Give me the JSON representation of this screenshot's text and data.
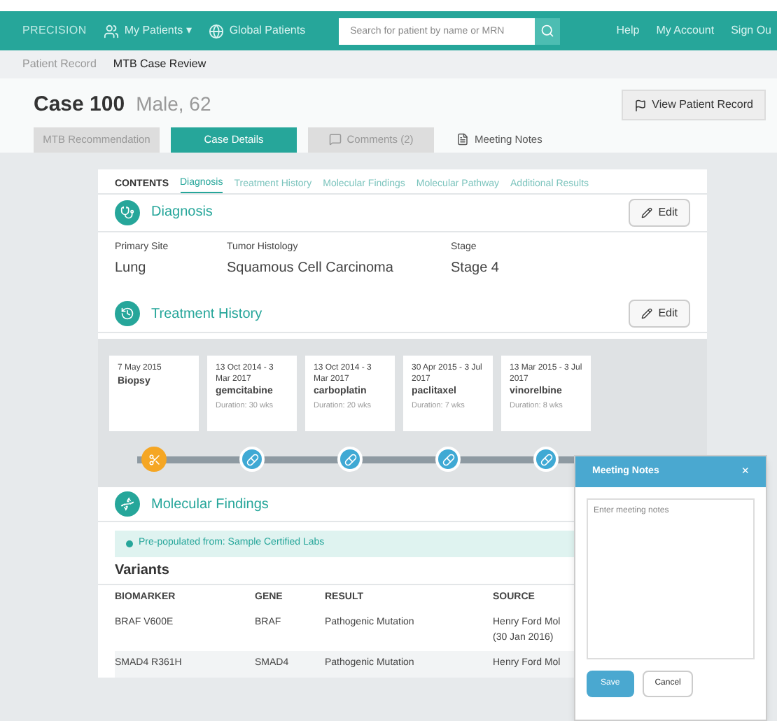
{
  "navbar": {
    "logo": "PRECISION",
    "menu": [
      {
        "label": "My Patients ▾",
        "kind": "patients"
      },
      {
        "label": "Global Patients",
        "kind": "globe"
      }
    ],
    "search": {
      "placeholder": "Search for patient by name or MRN"
    },
    "links": [
      "Help",
      "My Account",
      "Sign Ou"
    ]
  },
  "breadcrumb": [
    {
      "label": "Patient Record",
      "selected": false
    },
    {
      "label": "MTB Case Review",
      "selected": true
    }
  ],
  "header": {
    "title": "Case 100",
    "subtitle": "Male, 62",
    "button": "View Patient Record"
  },
  "tabs": [
    {
      "label": "MTB Recommendation",
      "selected": false,
      "kind": "plain"
    },
    {
      "label": "Case Details",
      "selected": true,
      "kind": "plain"
    },
    {
      "label": "Comments (2)",
      "selected": false,
      "kind": "comments"
    },
    {
      "label": "Meeting Notes",
      "selected": false,
      "kind": "link"
    }
  ],
  "contents": {
    "label": "CONTENTS",
    "items": [
      {
        "label": "Diagnosis",
        "selected": true
      },
      {
        "label": "Treatment History",
        "selected": false
      },
      {
        "label": "Molecular Findings",
        "selected": false
      },
      {
        "label": "Molecular Pathway",
        "selected": false
      },
      {
        "label": "Additional Results",
        "selected": false
      }
    ]
  },
  "diagnosis": {
    "title": "Diagnosis",
    "edit": "Edit",
    "fields": [
      {
        "label": "Primary Site",
        "value": "Lung"
      },
      {
        "label": "Tumor Histology",
        "value": "Squamous Cell Carcinoma"
      },
      {
        "label": "Stage",
        "value": "Stage 4"
      }
    ]
  },
  "treatment": {
    "title": "Treatment History",
    "edit": "Edit",
    "events": [
      {
        "kind": "procedure",
        "date": "7 May 2015",
        "name": "Biopsy"
      },
      {
        "kind": "drug",
        "date": "13 Oct 2014 - 3 Mar 2017",
        "name": "gemcitabine",
        "duration": "Duration: 30 wks"
      },
      {
        "kind": "drug",
        "date": "13 Oct 2014 - 3 Mar 2017",
        "name": "carboplatin",
        "duration": "Duration: 20 wks"
      },
      {
        "kind": "drug",
        "date": "30 Apr 2015 - 3 Jul 2017",
        "name": "paclitaxel",
        "duration": "Duration: 7 wks"
      },
      {
        "kind": "drug",
        "date": "13 Mar 2015 - 3 Jul 2017",
        "name": "vinorelbine",
        "duration": "Duration: 8 wks"
      }
    ]
  },
  "molecular": {
    "title": "Molecular Findings",
    "alert": "Pre-populated from: Sample Certified Labs",
    "subtitle": "Variants",
    "columns": [
      "BIOMARKER",
      "GENE",
      "RESULT",
      "SOURCE"
    ],
    "rows": [
      [
        "BRAF V600E",
        "BRAF",
        "Pathogenic Mutation",
        "Henry Ford Mol",
        "(30 Jan 2016)"
      ],
      [
        "SMAD4 R361H",
        "SMAD4",
        "Pathogenic Mutation",
        "Henry Ford Mol"
      ]
    ]
  },
  "meeting_notes": {
    "title": "Meeting Notes",
    "close": "×",
    "placeholder": "Enter meeting notes",
    "save": "Save",
    "cancel": "Cancel"
  }
}
